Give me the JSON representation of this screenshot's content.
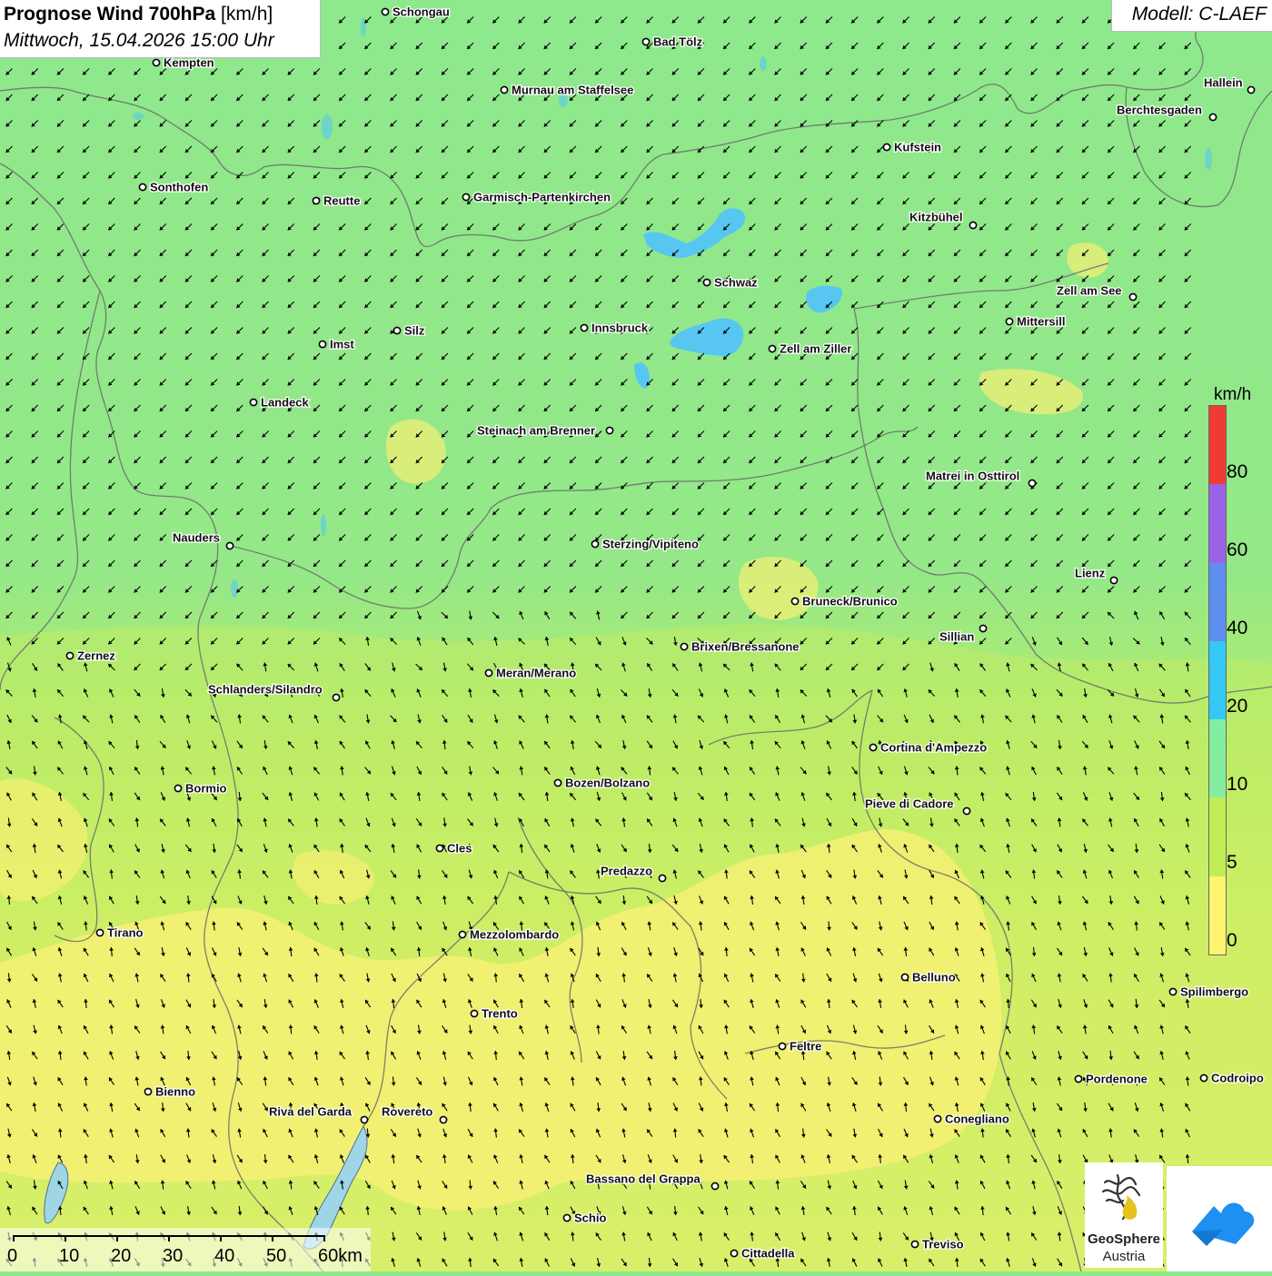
{
  "title": {
    "main": "Prognose Wind 700hPa",
    "unit": "[km/h]",
    "date": "Mittwoch, 15.04.2026 15:00 Uhr"
  },
  "model": "Modell: C-LAEF",
  "legend": {
    "unit": "km/h",
    "ticks": [
      "80",
      "60",
      "40",
      "20",
      "10",
      "5",
      "0"
    ],
    "colors": [
      "#f23a35",
      "#9a63e6",
      "#5f8fee",
      "#35c8f5",
      "#84eea0",
      "#c2ee55",
      "#fff470"
    ]
  },
  "scale": {
    "labels": [
      "0",
      "10",
      "20",
      "30",
      "40",
      "50",
      "60km"
    ]
  },
  "logo": {
    "name": "GeoSphere",
    "country": "Austria"
  },
  "colors": {
    "land_windy": "#8ee88c",
    "land_calm": "#f6f074",
    "lakes": "#57c7f2",
    "borders": "#6a6a6a"
  },
  "wind": {
    "north_direction": "south-west",
    "south_direction": "north",
    "arrow_color": "#000000"
  },
  "cities": [
    {
      "name": "Schongau",
      "anchor": "left"
    },
    {
      "name": "Bad Tölz",
      "anchor": "left"
    },
    {
      "name": "Kempten",
      "anchor": "left"
    },
    {
      "name": "Murnau am Staffelsee",
      "anchor": "left"
    },
    {
      "name": "Hallein",
      "anchor": "right"
    },
    {
      "name": "Berchtesgaden",
      "anchor": "right"
    },
    {
      "name": "Kufstein",
      "anchor": "left"
    },
    {
      "name": "Sonthofen",
      "anchor": "left"
    },
    {
      "name": "Reutte",
      "anchor": "left"
    },
    {
      "name": "Garmisch-Partenkirchen",
      "anchor": "left"
    },
    {
      "name": "Kitzbühel",
      "anchor": "right"
    },
    {
      "name": "Schwaz",
      "anchor": "left"
    },
    {
      "name": "Zell am See",
      "anchor": "right"
    },
    {
      "name": "Mittersill",
      "anchor": "left"
    },
    {
      "name": "Innsbruck",
      "anchor": "left"
    },
    {
      "name": "Imst",
      "anchor": "left"
    },
    {
      "name": "Silz",
      "anchor": "left"
    },
    {
      "name": "Zell am Ziller",
      "anchor": "left"
    },
    {
      "name": "Landeck",
      "anchor": "left"
    },
    {
      "name": "Steinach am Brenner",
      "anchor": "right"
    },
    {
      "name": "Matrei in Osttirol",
      "anchor": "right"
    },
    {
      "name": "Nauders",
      "anchor": "right"
    },
    {
      "name": "Sterzing/Vipiteno",
      "anchor": "left"
    },
    {
      "name": "Lienz",
      "anchor": "right"
    },
    {
      "name": "Bruneck/Brunico",
      "anchor": "left"
    },
    {
      "name": "Sillian",
      "anchor": "right"
    },
    {
      "name": "Brixen/Bressanone",
      "anchor": "left"
    },
    {
      "name": "Zernez",
      "anchor": "left"
    },
    {
      "name": "Meran/Merano",
      "anchor": "left"
    },
    {
      "name": "Schlanders/Silandro",
      "anchor": "right"
    },
    {
      "name": "Cortina d'Ampezzo",
      "anchor": "left"
    },
    {
      "name": "Bozen/Bolzano",
      "anchor": "left"
    },
    {
      "name": "Bormio",
      "anchor": "left"
    },
    {
      "name": "Pieve di Cadore",
      "anchor": "right"
    },
    {
      "name": "Cles",
      "anchor": "left"
    },
    {
      "name": "Predazzo",
      "anchor": "right"
    },
    {
      "name": "Tirano",
      "anchor": "left"
    },
    {
      "name": "Mezzolombardo",
      "anchor": "left"
    },
    {
      "name": "Belluno",
      "anchor": "left"
    },
    {
      "name": "Spilimbergo",
      "anchor": "left"
    },
    {
      "name": "Trento",
      "anchor": "left"
    },
    {
      "name": "Feltre",
      "anchor": "left"
    },
    {
      "name": "Pordenone",
      "anchor": "left"
    },
    {
      "name": "Codroipo",
      "anchor": "left"
    },
    {
      "name": "Bienno",
      "anchor": "left"
    },
    {
      "name": "Riva del Garda",
      "anchor": "right"
    },
    {
      "name": "Rovereto",
      "anchor": "right"
    },
    {
      "name": "Conegliano",
      "anchor": "left"
    },
    {
      "name": "Bassano del Grappa",
      "anchor": "right"
    },
    {
      "name": "Schio",
      "anchor": "left"
    },
    {
      "name": "Treviso",
      "anchor": "left"
    },
    {
      "name": "Cittadella",
      "anchor": "left"
    }
  ]
}
